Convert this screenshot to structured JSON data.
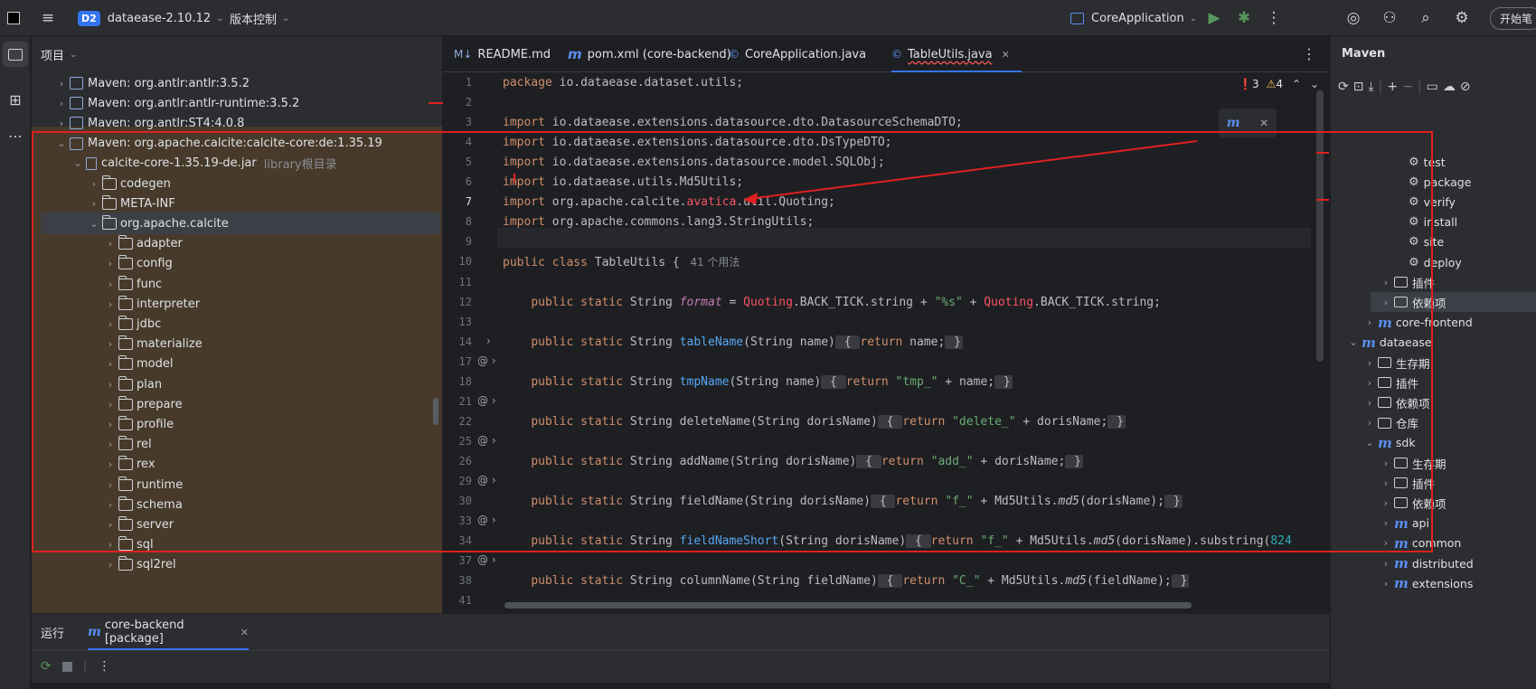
{
  "titlebar": {
    "project_badge": "D2",
    "project_name": "dataease-2.10.12",
    "vcs_label": "版本控制",
    "run_config": "CoreApplication",
    "right_button": "开始笔"
  },
  "project_panel": {
    "title": "项目",
    "tree": [
      {
        "label": "Maven: org.antlr:antlr:3.5.2",
        "type": "lib",
        "indent": 0,
        "chev": "›"
      },
      {
        "label": "Maven: org.antlr:antlr-runtime:3.5.2",
        "type": "lib",
        "indent": 0,
        "chev": "›"
      },
      {
        "label": "Maven: org.antlr:ST4:4.0.8",
        "type": "lib",
        "indent": 0,
        "chev": "›"
      },
      {
        "label": "Maven: org.apache.calcite:calcite-core:de:1.35.19",
        "type": "lib",
        "indent": 0,
        "chev": "⌄"
      },
      {
        "label": "calcite-core-1.35.19-de.jar",
        "hint": "library根目录",
        "type": "jar",
        "indent": 1,
        "chev": "⌄"
      },
      {
        "label": "codegen",
        "type": "folder",
        "indent": 2,
        "chev": "›"
      },
      {
        "label": "META-INF",
        "type": "folder",
        "indent": 2,
        "chev": "›"
      },
      {
        "label": "org.apache.calcite",
        "type": "folder",
        "indent": 2,
        "chev": "⌄",
        "selected": true
      },
      {
        "label": "adapter",
        "type": "folder",
        "indent": 3,
        "chev": "›"
      },
      {
        "label": "config",
        "type": "folder",
        "indent": 3,
        "chev": "›"
      },
      {
        "label": "func",
        "type": "folder",
        "indent": 3,
        "chev": "›"
      },
      {
        "label": "interpreter",
        "type": "folder",
        "indent": 3,
        "chev": "›"
      },
      {
        "label": "jdbc",
        "type": "folder",
        "indent": 3,
        "chev": "›"
      },
      {
        "label": "materialize",
        "type": "folder",
        "indent": 3,
        "chev": "›"
      },
      {
        "label": "model",
        "type": "folder",
        "indent": 3,
        "chev": "›"
      },
      {
        "label": "plan",
        "type": "folder",
        "indent": 3,
        "chev": "›"
      },
      {
        "label": "prepare",
        "type": "folder",
        "indent": 3,
        "chev": "›"
      },
      {
        "label": "profile",
        "type": "folder",
        "indent": 3,
        "chev": "›"
      },
      {
        "label": "rel",
        "type": "folder",
        "indent": 3,
        "chev": "›"
      },
      {
        "label": "rex",
        "type": "folder",
        "indent": 3,
        "chev": "›"
      },
      {
        "label": "runtime",
        "type": "folder",
        "indent": 3,
        "chev": "›"
      },
      {
        "label": "schema",
        "type": "folder",
        "indent": 3,
        "chev": "›"
      },
      {
        "label": "server",
        "type": "folder",
        "indent": 3,
        "chev": "›"
      },
      {
        "label": "sql",
        "type": "folder",
        "indent": 3,
        "chev": "›"
      },
      {
        "label": "sql2rel",
        "type": "folder",
        "indent": 3,
        "chev": "›"
      }
    ]
  },
  "editor": {
    "tabs": [
      {
        "label": "README.md",
        "icon": "M↓",
        "active": false
      },
      {
        "label": "pom.xml (core-backend)",
        "icon": "m",
        "active": false
      },
      {
        "label": "CoreApplication.java",
        "icon": "©",
        "active": false
      },
      {
        "label": "TableUtils.java",
        "icon": "©",
        "active": true
      }
    ],
    "inspections": {
      "errors": "3",
      "warnings": "4"
    },
    "usage_hint": "41 个用法",
    "line_numbers": [
      "1",
      "2",
      "3",
      "4",
      "5",
      "6",
      "7",
      "8",
      "9",
      "10",
      "11",
      "12",
      "13",
      "14",
      "17",
      "18",
      "21",
      "22",
      "25",
      "26",
      "29",
      "30",
      "33",
      "34",
      "37",
      "38",
      "41"
    ],
    "lines": [
      [
        [
          "kw",
          "package "
        ],
        [
          "",
          "io.dataease.dataset.utils;"
        ]
      ],
      [],
      [
        [
          "kw",
          "import "
        ],
        [
          "",
          "io.dataease.extensions.datasource.dto.DatasourceSchemaDTO;"
        ]
      ],
      [
        [
          "kw",
          "import "
        ],
        [
          "",
          "io.dataease.extensions.datasource.dto.DsTypeDTO;"
        ]
      ],
      [
        [
          "kw",
          "import "
        ],
        [
          "",
          "io.dataease.extensions.datasource.model.SQLObj;"
        ]
      ],
      [
        [
          "kw",
          "import "
        ],
        [
          "",
          "io.dataease.utils.Md5Utils;"
        ]
      ],
      [
        [
          "kw",
          "import "
        ],
        [
          "",
          "org.apache.calcite."
        ],
        [
          "err",
          "avatica"
        ],
        [
          "",
          ".util.Quoting;"
        ]
      ],
      [
        [
          "kw",
          "import "
        ],
        [
          "",
          "org.apache.commons.lang3.StringUtils;"
        ]
      ],
      [],
      [
        [
          "kw",
          "public class "
        ],
        [
          "",
          "TableUtils { "
        ],
        [
          "hint",
          " 41 个用法"
        ]
      ],
      [],
      [
        [
          "",
          "    "
        ],
        [
          "kw",
          "public static "
        ],
        [
          "",
          "String "
        ],
        [
          "fld",
          "format"
        ],
        [
          "",
          " = "
        ],
        [
          "err",
          "Quoting"
        ],
        [
          "",
          ".BACK_TICK.string + "
        ],
        [
          "str",
          "\"%s\""
        ],
        [
          "",
          " + "
        ],
        [
          "err",
          "Quoting"
        ],
        [
          "",
          ".BACK_TICK.string;"
        ]
      ],
      [],
      [
        [
          "",
          "    "
        ],
        [
          "kw",
          "public static "
        ],
        [
          "",
          "String "
        ],
        [
          "fn",
          "tableName"
        ],
        [
          "",
          "(String name)"
        ],
        [
          "fold",
          " { "
        ],
        [
          "kw",
          "return "
        ],
        [
          "",
          "name;"
        ],
        [
          "fold",
          " }"
        ]
      ],
      [],
      [
        [
          "",
          "    "
        ],
        [
          "kw",
          "public static "
        ],
        [
          "",
          "String "
        ],
        [
          "fn",
          "tmpName"
        ],
        [
          "",
          "(String name)"
        ],
        [
          "fold",
          " { "
        ],
        [
          "kw",
          "return "
        ],
        [
          "str",
          "\"tmp_\""
        ],
        [
          "",
          " + name;"
        ],
        [
          "fold",
          " }"
        ]
      ],
      [],
      [
        [
          "",
          "    "
        ],
        [
          "kw",
          "public static "
        ],
        [
          "",
          "String deleteName(String dorisName)"
        ],
        [
          "fold",
          " { "
        ],
        [
          "kw",
          "return "
        ],
        [
          "str",
          "\"delete_\""
        ],
        [
          "",
          " + dorisName;"
        ],
        [
          "fold",
          " }"
        ]
      ],
      [],
      [
        [
          "",
          "    "
        ],
        [
          "kw",
          "public static "
        ],
        [
          "",
          "String addName(String dorisName)"
        ],
        [
          "fold",
          " { "
        ],
        [
          "kw",
          "return "
        ],
        [
          "str",
          "\"add_\""
        ],
        [
          "",
          " + dorisName;"
        ],
        [
          "fold",
          " }"
        ]
      ],
      [],
      [
        [
          "",
          "    "
        ],
        [
          "kw",
          "public static "
        ],
        [
          "",
          "String fieldName(String dorisName)"
        ],
        [
          "fold",
          " { "
        ],
        [
          "kw",
          "return "
        ],
        [
          "str",
          "\"f_\""
        ],
        [
          "",
          " + Md5Utils."
        ],
        [
          "it",
          "md5"
        ],
        [
          "",
          "(dorisName);"
        ],
        [
          "fold",
          " }"
        ]
      ],
      [],
      [
        [
          "",
          "    "
        ],
        [
          "kw",
          "public static "
        ],
        [
          "",
          "String "
        ],
        [
          "fn",
          "fieldNameShort"
        ],
        [
          "",
          "(String dorisName)"
        ],
        [
          "fold",
          " { "
        ],
        [
          "kw",
          "return "
        ],
        [
          "str",
          "\"f_\""
        ],
        [
          "",
          " + Md5Utils."
        ],
        [
          "it",
          "md5"
        ],
        [
          "",
          "(dorisName).substring("
        ],
        [
          "num",
          "8"
        ],
        [
          ", "
        ],
        [
          "num",
          "24"
        ],
        [
          ")"
        ]
      ],
      [],
      [
        [
          "",
          "    "
        ],
        [
          "kw",
          "public static "
        ],
        [
          "",
          "String columnName(String fieldName)"
        ],
        [
          "fold",
          " { "
        ],
        [
          "kw",
          "return "
        ],
        [
          "str",
          "\"C_\""
        ],
        [
          "",
          " + Md5Utils."
        ],
        [
          "it",
          "md5"
        ],
        [
          "",
          "(fieldName);"
        ],
        [
          "fold",
          " }"
        ]
      ],
      []
    ]
  },
  "maven_panel": {
    "title": "Maven",
    "items": [
      {
        "label": "test",
        "kind": "goal",
        "indent": 3
      },
      {
        "label": "package",
        "kind": "goal",
        "indent": 3
      },
      {
        "label": "verify",
        "kind": "goal",
        "indent": 3
      },
      {
        "label": "install",
        "kind": "goal",
        "indent": 3
      },
      {
        "label": "site",
        "kind": "goal",
        "indent": 3
      },
      {
        "label": "deploy",
        "kind": "goal",
        "indent": 3
      },
      {
        "label": "插件",
        "kind": "folder",
        "indent": 2,
        "chev": "›"
      },
      {
        "label": "依赖项",
        "kind": "folder",
        "indent": 2,
        "chev": "›",
        "selected": true
      },
      {
        "label": "core-frontend",
        "kind": "module",
        "indent": 1,
        "chev": "›"
      },
      {
        "label": "dataease",
        "kind": "module",
        "indent": 0,
        "chev": "⌄"
      },
      {
        "label": "生存期",
        "kind": "folder",
        "indent": 1,
        "chev": "›"
      },
      {
        "label": "插件",
        "kind": "folder",
        "indent": 1,
        "chev": "›"
      },
      {
        "label": "依赖项",
        "kind": "folder",
        "indent": 1,
        "chev": "›"
      },
      {
        "label": "仓库",
        "kind": "folder",
        "indent": 1,
        "chev": "›"
      },
      {
        "label": "sdk",
        "kind": "module",
        "indent": 1,
        "chev": "⌄"
      },
      {
        "label": "生存期",
        "kind": "folder",
        "indent": 2,
        "chev": "›"
      },
      {
        "label": "插件",
        "kind": "folder",
        "indent": 2,
        "chev": "›"
      },
      {
        "label": "依赖项",
        "kind": "folder",
        "indent": 2,
        "chev": "›"
      },
      {
        "label": "api",
        "kind": "module",
        "indent": 2,
        "chev": "›"
      },
      {
        "label": "common",
        "kind": "module",
        "indent": 2,
        "chev": "›"
      },
      {
        "label": "distributed",
        "kind": "module",
        "indent": 2,
        "chev": "›"
      },
      {
        "label": "extensions",
        "kind": "module",
        "indent": 2,
        "chev": "›"
      }
    ]
  },
  "bottom_panel": {
    "run_label": "运行",
    "run_tab": "core-backend [package]"
  },
  "colors": {
    "accent": "#3574f0",
    "annotation": "#e02020",
    "library_bg": "#473a2a"
  }
}
